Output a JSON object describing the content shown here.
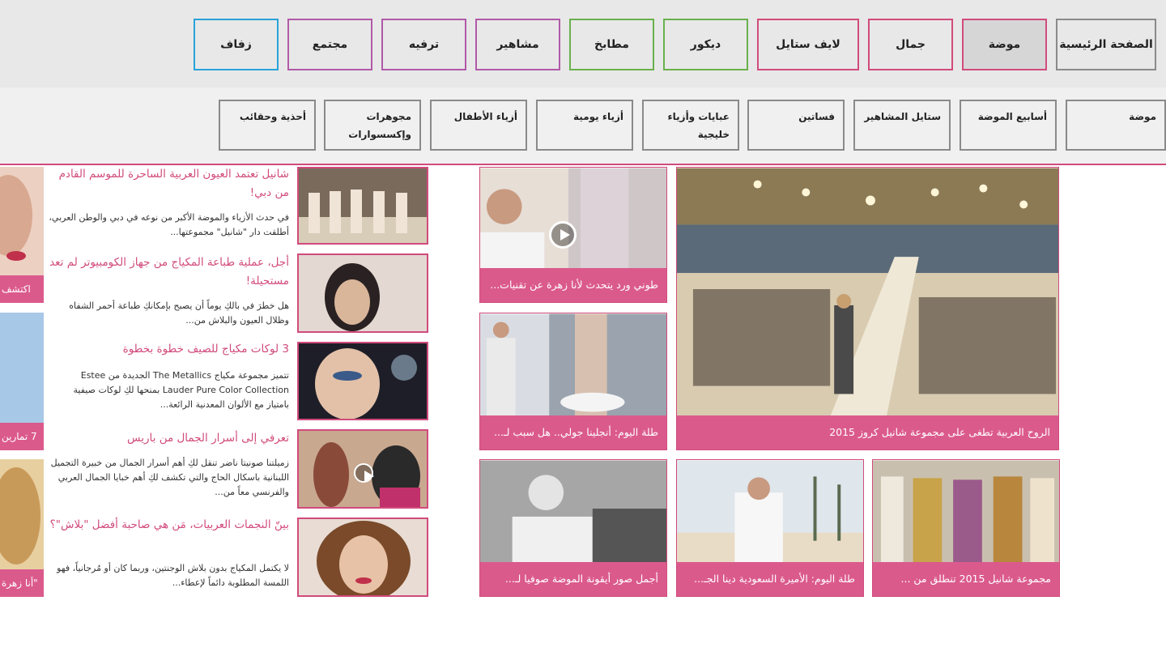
{
  "top_nav": [
    {
      "label": "الصفحة الرئيسية",
      "border": "#8a8a8a"
    },
    {
      "label": "موضة",
      "border": "#d14b7c",
      "active": true
    },
    {
      "label": "جمال",
      "border": "#d14b7c"
    },
    {
      "label": "لايف ستايل",
      "border": "#d14b7c"
    },
    {
      "label": "ديكور",
      "border": "#6ab04c"
    },
    {
      "label": "مطابخ",
      "border": "#6ab04c"
    },
    {
      "label": "مشاهير",
      "border": "#b05aa8"
    },
    {
      "label": "ترفيه",
      "border": "#b05aa8"
    },
    {
      "label": "مجتمع",
      "border": "#b05aa8"
    },
    {
      "label": "زفاف",
      "border": "#29a3d9"
    }
  ],
  "sub_nav": [
    {
      "label": "موضة"
    },
    {
      "label": "أسابيع الموضة"
    },
    {
      "label": "ستايل المشاهير"
    },
    {
      "label": "فساتين"
    },
    {
      "label": "عبايات وأزياء خليجية"
    },
    {
      "label": "أزياء يومية"
    },
    {
      "label": "أزياء الأطفال"
    },
    {
      "label": "مجوهرات وإكسسوارات"
    },
    {
      "label": "أحذية وحقائب"
    }
  ],
  "tiles": {
    "main": "الروح العربية تطغى على مجموعة شانيل كروز 2015",
    "video": "طوني ورد يتحدث لأنا زهرة عن تقنيات...",
    "angelina": "طلة اليوم: أنجلينا جولي.. هل سبب لـ...",
    "chanel_2015": "مجموعة شانيل 2015 تنطلق من ...",
    "princess": "طلة اليوم: الأميرة السعودية دينا الجـ...",
    "sophia": "أجمل صور أيقونة الموضة صوفيا لـ..."
  },
  "articles": [
    {
      "title": "شانيل تعتمد العيون العربية الساحرة للموسم القادم من دبي!",
      "desc": "في حدث الأزياء والموضة الأكبر من نوعه في دبي والوطن العربي، أطلقت دار \"شانيل\" مجموعتها..."
    },
    {
      "title": "أجل، عملية طباعة المكياج من جهاز الكومبيوتر لم تعد مستحيلة!",
      "desc": "هل خطرَ في بالكِ يوماً أن يصبح بإمكانكِ طباعة أحمر الشفاه وظلال العيون والبلاش من..."
    },
    {
      "title": "3 لوكات مكياج للصيف خطوة بخطوة",
      "desc": "تتميز مجموعة مكياج The Metallics الجديدة من Estee Lauder Pure Color Collection بمنحها لكِ لوكات صيفية بامتياز مع الألوان المعدنية الرائعة..."
    },
    {
      "title": "تعرفي إلى أسرار الجمال من باريس",
      "desc": "زميلتنا صونيتا ناضر تنقل لكِ أهم أسرار الجمال من خبيرة التجميل اللبنانية باسكال الحاج والتي تكشف لكِ أهم خبايا الجمال العربي والفرنسي معاً من..."
    },
    {
      "title": "بينّ النجمات العربيات، مَن هي صاحبة أفضل \"بلاش\"؟",
      "desc": "لا يكتمل المكياج بدون بلاش الوجنتين، وربما كان أو مُرجانياً، فهو اللمسة المطلوبة دائماً لإعطاء..."
    }
  ],
  "edge_tiles": [
    "اكتشف",
    "7 تمارين",
    "\"أنا زهرة"
  ],
  "colors": {
    "accent": "#d14b7c",
    "caption_bg": "#db5a8c",
    "green": "#6ab04c",
    "purple": "#b05aa8",
    "blue": "#29a3d9"
  }
}
